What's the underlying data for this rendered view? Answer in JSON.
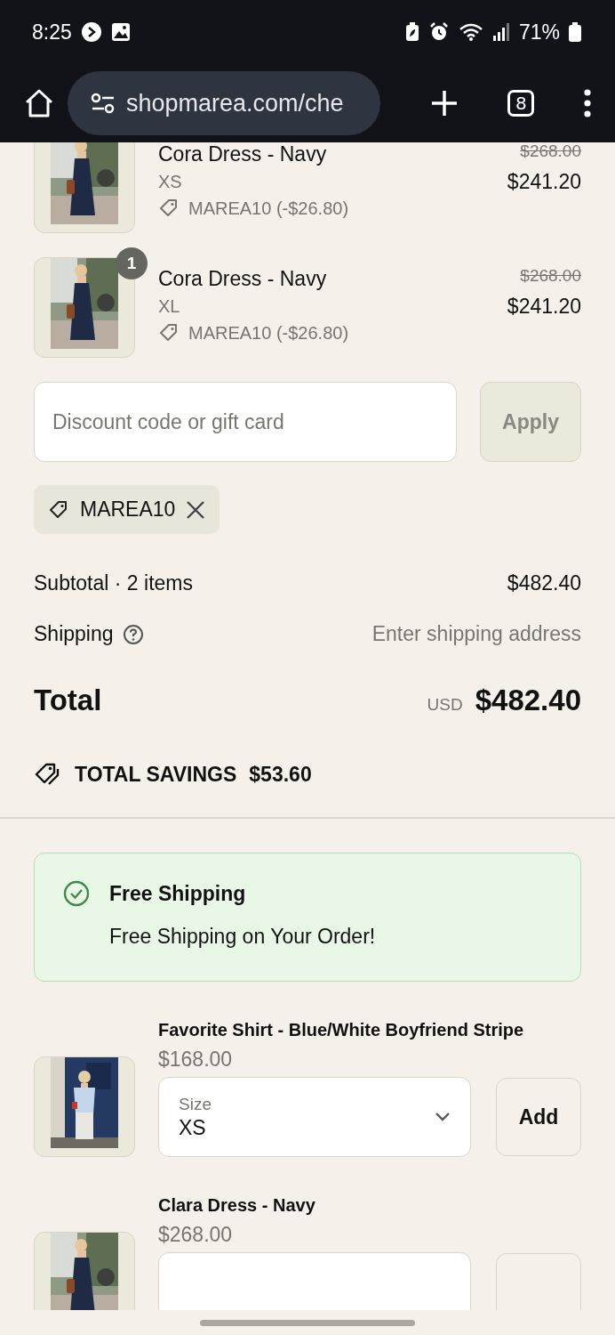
{
  "status_bar": {
    "time": "8:25",
    "battery": "71%"
  },
  "browser": {
    "url": "shopmarea.com/che",
    "tab_count": "8"
  },
  "cart_items": [
    {
      "name": "Cora Dress - Navy",
      "variant": "XS",
      "discount": "MAREA10 (-$26.80)",
      "original_price": "$268.00",
      "price": "$241.20"
    },
    {
      "quantity": "1",
      "name": "Cora Dress - Navy",
      "variant": "XL",
      "discount": "MAREA10 (-$26.80)",
      "original_price": "$268.00",
      "price": "$241.20"
    }
  ],
  "discount_field": {
    "placeholder": "Discount code or gift card"
  },
  "apply_button": {
    "label": "Apply",
    "disabled": true
  },
  "applied_codes": [
    {
      "code": "MAREA10"
    }
  ],
  "summary": {
    "subtotal_label": "Subtotal · 2 items",
    "subtotal": "$482.40",
    "shipping_label": "Shipping",
    "shipping_value": "Enter shipping address",
    "total_label": "Total",
    "currency": "USD",
    "total": "$482.40",
    "savings_label": "TOTAL SAVINGS",
    "savings": "$53.60"
  },
  "notice": {
    "title": "Free Shipping",
    "message": "Free Shipping on Your Order!"
  },
  "recommendations": [
    {
      "name": "Favorite Shirt - Blue/White Boyfriend Stripe",
      "price": "$168.00",
      "size_label": "Size",
      "size": "XS",
      "button": "Add"
    },
    {
      "name": "Clara Dress - Navy",
      "price": "$268.00"
    }
  ]
}
